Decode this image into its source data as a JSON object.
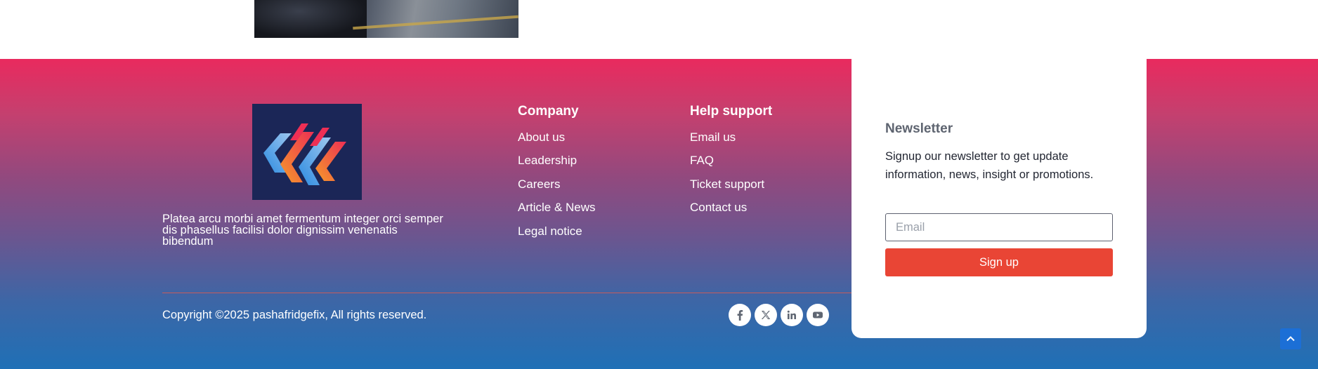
{
  "brand": {
    "description": "Platea arcu morbi amet fermentum integer orci semper dis phasellus facilisi dolor dignissim venenatis bibendum"
  },
  "company": {
    "title": "Company",
    "links": [
      "About us",
      "Leadership",
      "Careers",
      "Article & News",
      "Legal notice"
    ]
  },
  "help": {
    "title": "Help support",
    "links": [
      "Email us",
      "FAQ",
      "Ticket support",
      "Contact us"
    ]
  },
  "newsletter": {
    "title": "Newsletter",
    "text": "Signup our newsletter to get update information, news, insight or promotions.",
    "email_placeholder": "Email",
    "email_value": "",
    "button_label": "Sign up"
  },
  "footer": {
    "copyright": "Copyright ©2025 pashafridgefix, All rights reserved."
  },
  "social": [
    "facebook-icon",
    "x-twitter-icon",
    "linkedin-icon",
    "youtube-icon"
  ],
  "colors": {
    "gradient_top": "#e92a5e",
    "gradient_bottom": "#1f70b6",
    "signup_button": "#e94535",
    "scroll_top_button": "#1c6fd6",
    "logo_background": "#1b2657"
  }
}
